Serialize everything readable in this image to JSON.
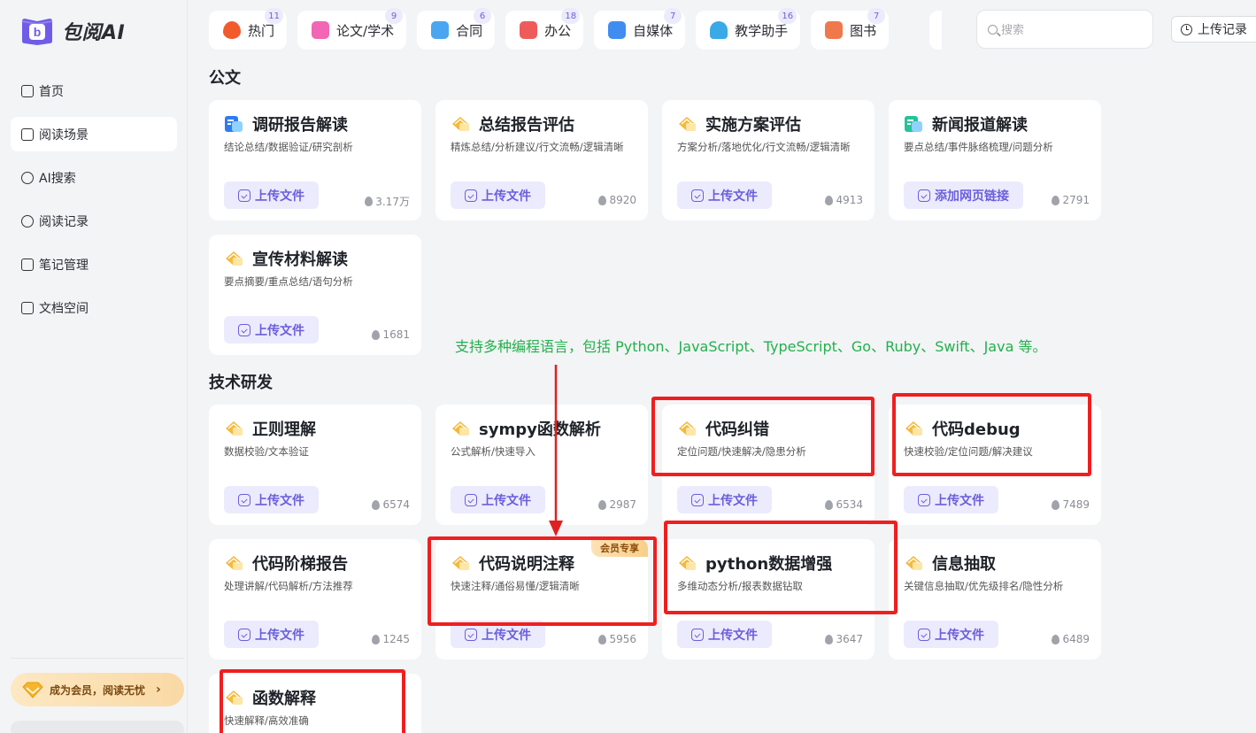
{
  "brand": {
    "name": "包阅AI"
  },
  "sidebar": {
    "items": [
      {
        "label": "首页",
        "icon": "home-icon"
      },
      {
        "label": "阅读场景",
        "icon": "cube-icon"
      },
      {
        "label": "AI搜索",
        "icon": "search-spark-icon"
      },
      {
        "label": "阅读记录",
        "icon": "clock-icon"
      },
      {
        "label": "笔记管理",
        "icon": "book-icon"
      },
      {
        "label": "文档空间",
        "icon": "folder-icon"
      }
    ],
    "vip_label": "成为会员，阅读无忧",
    "vip_arrow": "›"
  },
  "categories": [
    {
      "label": "热门",
      "badge": "11",
      "color": "#f25a2c"
    },
    {
      "label": "论文/学术",
      "badge": "9",
      "color": "#f266b5"
    },
    {
      "label": "合同",
      "badge": "6",
      "color": "#4aa6f0"
    },
    {
      "label": "办公",
      "badge": "18",
      "color": "#ef5b5b"
    },
    {
      "label": "自媒体",
      "badge": "7",
      "color": "#3f8df0"
    },
    {
      "label": "教学助手",
      "badge": "16",
      "color": "#39a9e8"
    },
    {
      "label": "图书",
      "badge": "7",
      "color": "#f0784d"
    }
  ],
  "search": {
    "placeholder": "搜索"
  },
  "upload_records": "上传记录",
  "sections": {
    "gongwen": "公文",
    "tech": "技术研发"
  },
  "cards": [
    {
      "title": "调研报告解读",
      "desc": "结论总结/数据验证/研究剖析",
      "button": "上传文件",
      "count": "3.17万"
    },
    {
      "title": "总结报告评估",
      "desc": "精炼总结/分析建议/行文流畅/逻辑清晰",
      "button": "上传文件",
      "count": "8920"
    },
    {
      "title": "实施方案评估",
      "desc": "方案分析/落地优化/行文流畅/逻辑清晰",
      "button": "上传文件",
      "count": "4913"
    },
    {
      "title": "新闻报道解读",
      "desc": "要点总结/事件脉络梳理/问题分析",
      "button": "添加网页链接",
      "count": "2791"
    },
    {
      "title": "宣传材料解读",
      "desc": "要点摘要/重点总结/语句分析",
      "button": "上传文件",
      "count": "1681"
    },
    {
      "title": "正则理解",
      "desc": "数据校验/文本验证",
      "button": "上传文件",
      "count": "6574"
    },
    {
      "title": "sympy函数解析",
      "desc": "公式解析/快速导入",
      "button": "上传文件",
      "count": "2987"
    },
    {
      "title": "代码纠错",
      "desc": "定位问题/快速解决/隐患分析",
      "button": "上传文件",
      "count": "6534"
    },
    {
      "title": "代码debug",
      "desc": "快速校验/定位问题/解决建议",
      "button": "上传文件",
      "count": "7489"
    },
    {
      "title": "代码阶梯报告",
      "desc": "处理讲解/代码解析/方法推荐",
      "button": "上传文件",
      "count": "1245"
    },
    {
      "title": "代码说明注释",
      "desc": "快速注释/通俗易懂/逻辑清晰",
      "button": "上传文件",
      "count": "5956",
      "tag": "会员专享"
    },
    {
      "title": "python数据增强",
      "desc": "多维动态分析/报表数据钻取",
      "button": "上传文件",
      "count": "3647"
    },
    {
      "title": "信息抽取",
      "desc": "关键信息抽取/优先级排名/隐性分析",
      "button": "上传文件",
      "count": "6489"
    },
    {
      "title": "函数解释",
      "desc": "快速解释/高效准确"
    }
  ],
  "annotation": "支持多种编程语言，包括 Python、JavaScript、TypeScript、Go、Ruby、Swift、Java 等。"
}
